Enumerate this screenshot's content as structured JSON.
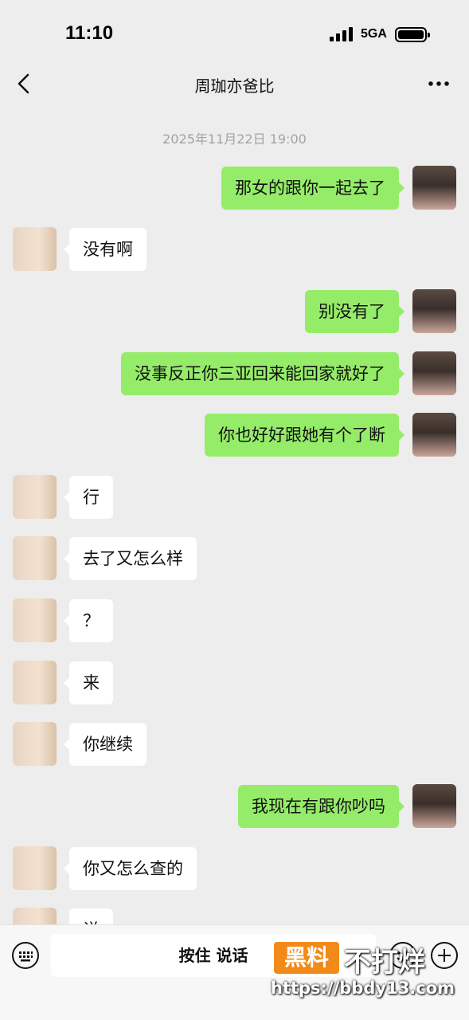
{
  "status_bar": {
    "time": "11:10",
    "network": "5GA"
  },
  "nav": {
    "title": "周珈亦爸比"
  },
  "timestamp": "2025年11月22日 19:00",
  "messages": [
    {
      "side": "out",
      "text": "那女的跟你一起去了"
    },
    {
      "side": "in",
      "text": "没有啊"
    },
    {
      "side": "out",
      "text": "别没有了"
    },
    {
      "side": "out",
      "text": "没事反正你三亚回来能回家就好了"
    },
    {
      "side": "out",
      "text": "你也好好跟她有个了断"
    },
    {
      "side": "in",
      "text": "行"
    },
    {
      "side": "in",
      "text": "去了又怎么样"
    },
    {
      "side": "in",
      "text": "？"
    },
    {
      "side": "in",
      "text": "来"
    },
    {
      "side": "in",
      "text": "你继续"
    },
    {
      "side": "out",
      "text": "我现在有跟你吵吗"
    },
    {
      "side": "in",
      "text": "你又怎么查的"
    },
    {
      "side": "in",
      "text": "说"
    }
  ],
  "input_bar": {
    "voice_label": "按住 说话"
  },
  "watermark": {
    "tag": "黑料",
    "text": "不打烊",
    "url": "https://bbdy13.com"
  },
  "colors": {
    "background": "#ededed",
    "outgoing_bubble": "#95ec69",
    "incoming_bubble": "#ffffff",
    "timestamp": "#a3a3a3"
  },
  "icons": [
    "back-icon",
    "more-icon",
    "keyboard-icon",
    "emoji-icon",
    "plus-icon"
  ]
}
